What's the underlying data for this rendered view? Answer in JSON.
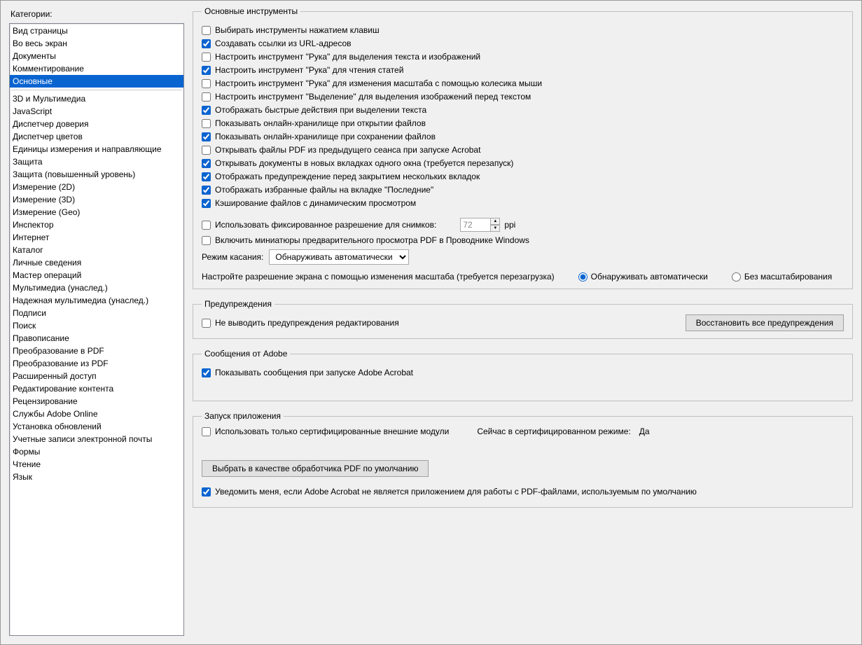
{
  "sidebar": {
    "title": "Категории:",
    "group1": [
      "Вид страницы",
      "Во весь экран",
      "Документы",
      "Комментирование",
      "Основные"
    ],
    "selected_index": 4,
    "group2": [
      "3D и Мультимедиа",
      "JavaScript",
      "Диспетчер доверия",
      "Диспетчер цветов",
      "Единицы измерения и направляющие",
      "Защита",
      "Защита (повышенный уровень)",
      "Измерение (2D)",
      "Измерение (3D)",
      "Измерение (Geo)",
      "Инспектор",
      "Интернет",
      "Каталог",
      "Личные сведения",
      "Мастер операций",
      "Мультимедиа (унаслед.)",
      "Надежная мультимедиа (унаслед.)",
      "Подписи",
      "Поиск",
      "Правописание",
      "Преобразование в PDF",
      "Преобразование из PDF",
      "Расширенный доступ",
      "Редактирование контента",
      "Рецензирование",
      "Службы Adobe Online",
      "Установка обновлений",
      "Учетные записи электронной почты",
      "Формы",
      "Чтение",
      "Язык"
    ]
  },
  "main_tools": {
    "legend": "Основные инструменты",
    "items": [
      {
        "label": "Выбирать инструменты нажатием клавиш",
        "checked": false
      },
      {
        "label": "Создавать ссылки из URL-адресов",
        "checked": true
      },
      {
        "label": "Настроить инструмент \"Рука\" для выделения текста и изображений",
        "checked": false
      },
      {
        "label": "Настроить инструмент \"Рука\" для чтения статей",
        "checked": true
      },
      {
        "label": "Настроить инструмент \"Рука\" для изменения масштаба с помощью колесика мыши",
        "checked": false
      },
      {
        "label": "Настроить инструмент \"Выделение\" для выделения изображений перед текстом",
        "checked": false
      },
      {
        "label": "Отображать быстрые действия при выделении текста",
        "checked": true
      },
      {
        "label": "Показывать онлайн-хранилище при открытии файлов",
        "checked": false
      },
      {
        "label": "Показывать онлайн-хранилище при сохранении файлов",
        "checked": true
      },
      {
        "label": "Открывать файлы PDF из предыдущего сеанса при запуске Acrobat",
        "checked": false
      },
      {
        "label": "Открывать документы в новых вкладках одного окна (требуется перезапуск)",
        "checked": true
      },
      {
        "label": "Отображать предупреждение перед закрытием нескольких вкладок",
        "checked": true
      },
      {
        "label": "Отображать избранные файлы на вкладке \"Последние\"",
        "checked": true
      },
      {
        "label": "Кэширование файлов с динамическим просмотром",
        "checked": true
      }
    ],
    "fixed_res": {
      "label": "Использовать фиксированное разрешение для снимков:",
      "checked": false,
      "value": "72",
      "unit": "ppi"
    },
    "win_thumb": {
      "label": "Включить миниатюры предварительного просмотра PDF в Проводнике Windows",
      "checked": false
    },
    "touch_mode": {
      "label": "Режим касания:",
      "selected": "Обнаруживать автоматически"
    },
    "scale_row": {
      "label": "Настройте разрешение экрана с помощью изменения масштаба (требуется перезагрузка)",
      "option_auto": "Обнаруживать автоматически",
      "option_none": "Без масштабирования",
      "selected": "auto"
    }
  },
  "warnings": {
    "legend": "Предупреждения",
    "suppress": {
      "label": "Не выводить предупреждения редактирования",
      "checked": false
    },
    "reset_button": "Восстановить все предупреждения"
  },
  "adobe_msgs": {
    "legend": "Сообщения от Adobe",
    "show": {
      "label": "Показывать сообщения при запуске Adobe Acrobat",
      "checked": true
    }
  },
  "startup": {
    "legend": "Запуск приложения",
    "cert_only": {
      "label": "Использовать только сертифицированные внешние модули",
      "checked": false
    },
    "cert_mode_label": "Сейчас в сертифицированном режиме:",
    "cert_mode_value": "Да",
    "default_handler_button": "Выбрать в качестве обработчика PDF по умолчанию",
    "notify_default": {
      "label": "Уведомить меня, если Adobe Acrobat не является приложением для работы с PDF-файлами, используемым по умолчанию",
      "checked": true
    }
  }
}
